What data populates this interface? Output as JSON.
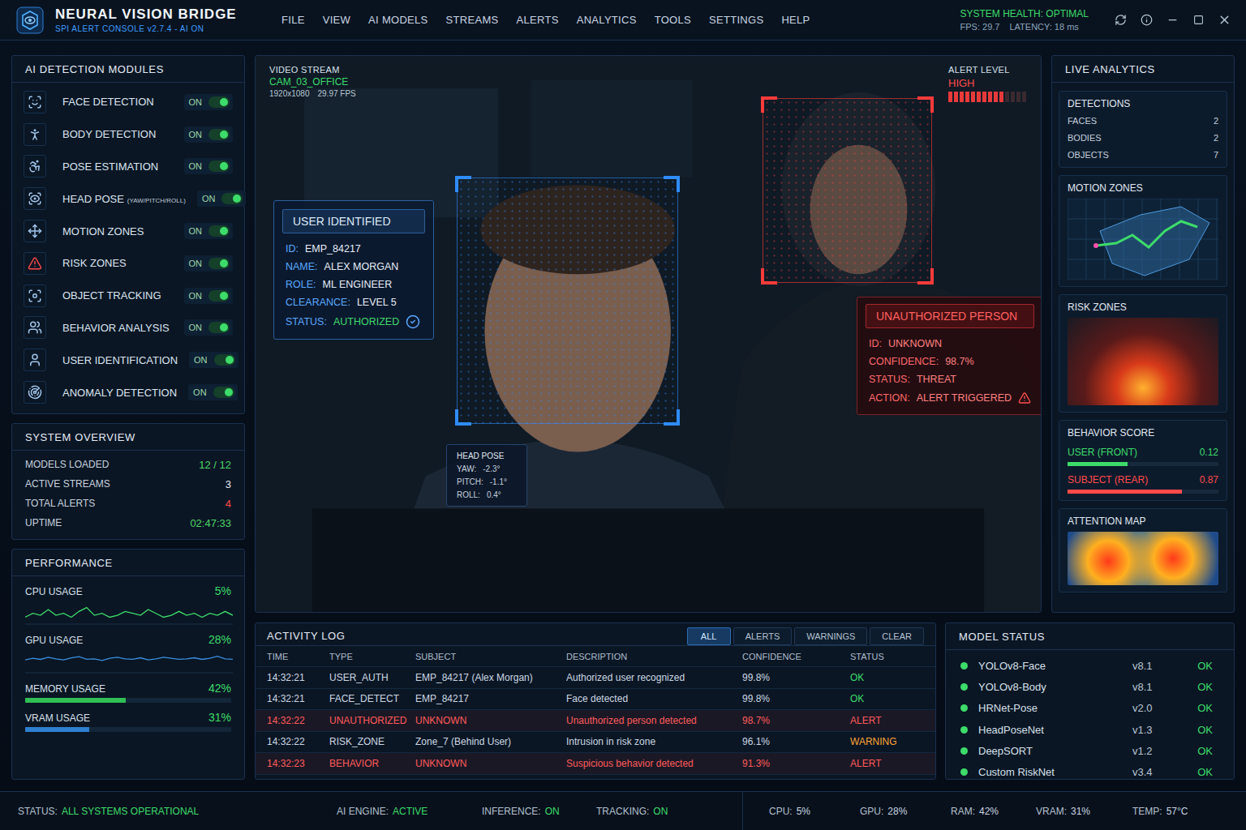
{
  "header": {
    "title": "NEURAL VISION BRIDGE",
    "subtitle": "SPI ALERT CONSOLE v2.7.4 - AI ON",
    "menu": [
      "FILE",
      "VIEW",
      "AI MODELS",
      "STREAMS",
      "ALERTS",
      "ANALYTICS",
      "TOOLS",
      "SETTINGS",
      "HELP"
    ],
    "health": "SYSTEM HEALTH: OPTIMAL",
    "fps": "FPS: 29.7",
    "latency": "LATENCY: 18 ms"
  },
  "modules": {
    "title": "AI DETECTION MODULES",
    "items": [
      {
        "name": "FACE DETECTION",
        "state": "ON",
        "on": true
      },
      {
        "name": "BODY DETECTION",
        "state": "ON",
        "on": true
      },
      {
        "name": "POSE ESTIMATION",
        "state": "ON",
        "on": true
      },
      {
        "name": "HEAD POSE",
        "sub": "(YAW/PITCH/ROLL)",
        "state": "ON",
        "on": true
      },
      {
        "name": "MOTION ZONES",
        "state": "ON",
        "on": true
      },
      {
        "name": "RISK ZONES",
        "state": "ON",
        "on": true
      },
      {
        "name": "OBJECT TRACKING",
        "state": "ON",
        "on": true
      },
      {
        "name": "BEHAVIOR ANALYSIS",
        "state": "ON",
        "on": true
      },
      {
        "name": "USER IDENTIFICATION",
        "state": "ON",
        "on": true
      },
      {
        "name": "ANOMALY DETECTION",
        "state": "ON",
        "on": true
      }
    ]
  },
  "overview": {
    "title": "SYSTEM OVERVIEW",
    "rows": [
      {
        "label": "MODELS LOADED",
        "value": "12 / 12",
        "color": "#4cd964"
      },
      {
        "label": "ACTIVE STREAMS",
        "value": "3",
        "color": "#e6edf5"
      },
      {
        "label": "TOTAL ALERTS",
        "value": "4",
        "color": "#ff4a4a"
      },
      {
        "label": "UPTIME",
        "value": "02:47:33",
        "color": "#4cd964"
      }
    ]
  },
  "performance": {
    "title": "PERFORMANCE",
    "items": [
      {
        "label": "CPU USAGE",
        "value": "5%",
        "kind": "sparkline",
        "color": "#3ddc6a",
        "values": [
          4,
          6,
          5,
          8,
          5,
          6,
          4,
          7,
          9,
          5,
          6,
          4,
          5,
          7,
          6,
          5,
          8,
          6,
          4,
          5,
          7,
          5,
          6,
          4,
          6,
          5,
          7,
          5
        ]
      },
      {
        "label": "GPU USAGE",
        "value": "28%",
        "kind": "sparkline",
        "color": "#3b8fe0",
        "values": [
          26,
          29,
          27,
          31,
          28,
          26,
          30,
          32,
          27,
          28,
          25,
          29,
          31,
          28,
          27,
          30,
          26,
          28,
          31,
          29,
          27,
          28,
          30,
          27,
          29,
          33,
          28,
          27
        ]
      },
      {
        "label": "MEMORY USAGE",
        "value": "42%",
        "kind": "bar",
        "color": "#2fbf55",
        "level": 0.49
      },
      {
        "label": "VRAM USAGE",
        "value": "31%",
        "kind": "bar",
        "color": "#2f7fd0",
        "level": 0.31
      }
    ]
  },
  "video": {
    "label": "VIDEO STREAM",
    "camera": "CAM_03_OFFICE",
    "resolution": "1920x1080",
    "fps": "29.97 FPS",
    "alert": {
      "label": "ALERT LEVEL",
      "value": "HIGH",
      "level": 0.72
    },
    "user": {
      "title": "USER IDENTIFIED",
      "fields": [
        {
          "label": "ID:",
          "value": "EMP_84217",
          "verified": false
        },
        {
          "label": "NAME:",
          "value": "ALEX MORGAN",
          "verified": false
        },
        {
          "label": "ROLE:",
          "value": "ML ENGINEER",
          "verified": false
        },
        {
          "label": "CLEARANCE:",
          "value": "LEVEL 5",
          "verified": false
        },
        {
          "label": "STATUS:",
          "value": "AUTHORIZED",
          "verified": true
        }
      ]
    },
    "headPose": {
      "title": "HEAD POSE",
      "rows": [
        {
          "label": "YAW:",
          "value": "-2.3°"
        },
        {
          "label": "PITCH:",
          "value": "-1.1°"
        },
        {
          "label": "ROLL:",
          "value": "0.4°"
        }
      ]
    },
    "threat": {
      "title": "UNAUTHORIZED PERSON",
      "fields": [
        {
          "label": "ID:",
          "value": "UNKNOWN",
          "warning": false
        },
        {
          "label": "CONFIDENCE:",
          "value": "98.7%",
          "warning": false
        },
        {
          "label": "STATUS:",
          "value": "THREAT",
          "warning": false
        },
        {
          "label": "ACTION:",
          "value": "ALERT TRIGGERED",
          "warning": true
        }
      ]
    }
  },
  "analytics": {
    "title": "LIVE ANALYTICS",
    "detections": {
      "title": "DETECTIONS",
      "rows": [
        {
          "label": "FACES",
          "value": "2"
        },
        {
          "label": "BODIES",
          "value": "2"
        },
        {
          "label": "OBJECTS",
          "value": "7"
        }
      ]
    },
    "motion": {
      "title": "MOTION ZONES"
    },
    "risk": {
      "title": "RISK ZONES"
    },
    "behavior": {
      "title": "BEHAVIOR SCORE",
      "rows": [
        {
          "label": "USER (FRONT)",
          "value": "0.12",
          "level": 0.4,
          "color": "#3ddc6a"
        },
        {
          "label": "SUBJECT (REAR)",
          "value": "0.87",
          "level": 0.76,
          "color": "#ff4a4a"
        }
      ]
    },
    "attention": {
      "title": "ATTENTION MAP"
    }
  },
  "log": {
    "title": "ACTIVITY LOG",
    "filters": [
      {
        "label": "ALL",
        "selected": true
      },
      {
        "label": "ALERTS",
        "selected": false
      },
      {
        "label": "WARNINGS",
        "selected": false
      },
      {
        "label": "CLEAR",
        "selected": false
      }
    ],
    "columns": [
      "TIME",
      "TYPE",
      "SUBJECT",
      "DESCRIPTION",
      "CONFIDENCE",
      "STATUS"
    ],
    "rows": [
      {
        "time": "14:32:21",
        "type": "USER_AUTH",
        "subject": "EMP_84217 (Alex Morgan)",
        "description": "Authorized user recognized",
        "confidence": "99.8%",
        "status": "OK",
        "kind": "ok"
      },
      {
        "time": "14:32:21",
        "type": "FACE_DETECT",
        "subject": "EMP_84217",
        "description": "Face detected",
        "confidence": "99.8%",
        "status": "OK",
        "kind": "ok"
      },
      {
        "time": "14:32:22",
        "type": "UNAUTHORIZED",
        "subject": "UNKNOWN",
        "description": "Unauthorized person detected",
        "confidence": "98.7%",
        "status": "ALERT",
        "kind": "alert"
      },
      {
        "time": "14:32:22",
        "type": "RISK_ZONE",
        "subject": "Zone_7 (Behind User)",
        "description": "Intrusion in risk zone",
        "confidence": "96.1%",
        "status": "WARNING",
        "kind": "warning"
      },
      {
        "time": "14:32:23",
        "type": "BEHAVIOR",
        "subject": "UNKNOWN",
        "description": "Suspicious behavior detected",
        "confidence": "91.3%",
        "status": "ALERT",
        "kind": "alert"
      }
    ]
  },
  "models": {
    "title": "MODEL STATUS",
    "rows": [
      {
        "name": "YOLOv8-Face",
        "version": "v8.1",
        "status": "OK",
        "color": "#3ddc6a"
      },
      {
        "name": "YOLOv8-Body",
        "version": "v8.1",
        "status": "OK",
        "color": "#3ddc6a"
      },
      {
        "name": "HRNet-Pose",
        "version": "v2.0",
        "status": "OK",
        "color": "#3ddc6a"
      },
      {
        "name": "HeadPoseNet",
        "version": "v1.3",
        "status": "OK",
        "color": "#3ddc6a"
      },
      {
        "name": "DeepSORT",
        "version": "v1.2",
        "status": "OK",
        "color": "#3ddc6a"
      },
      {
        "name": "Custom RiskNet",
        "version": "v3.4",
        "status": "OK",
        "color": "#3ddc6a"
      }
    ]
  },
  "statusBar": {
    "left": [
      {
        "label": "STATUS:",
        "value": "ALL SYSTEMS OPERATIONAL"
      },
      {
        "label": "AI ENGINE:",
        "value": "ACTIVE"
      },
      {
        "label": "INFERENCE:",
        "value": "ON"
      },
      {
        "label": "TRACKING:",
        "value": "ON"
      }
    ],
    "right": [
      {
        "label": "CPU:",
        "value": "5%"
      },
      {
        "label": "GPU:",
        "value": "28%"
      },
      {
        "label": "RAM:",
        "value": "42%"
      },
      {
        "label": "VRAM:",
        "value": "31%"
      },
      {
        "label": "TEMP:",
        "value": "57°C"
      }
    ]
  }
}
